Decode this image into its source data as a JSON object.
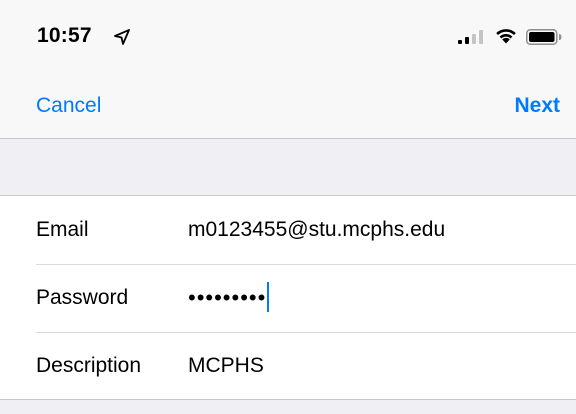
{
  "status_bar": {
    "time": "10:57",
    "location_icon": "location-arrow-icon",
    "signal_icon": "cellular-signal-icon",
    "wifi_icon": "wifi-icon",
    "battery_icon": "battery-icon"
  },
  "nav": {
    "cancel_label": "Cancel",
    "next_label": "Next"
  },
  "form": {
    "rows": [
      {
        "label": "Email",
        "value": "m0123455@stu.mcphs.edu"
      },
      {
        "label": "Password",
        "value": "•••••••••"
      },
      {
        "label": "Description",
        "value": "MCPHS"
      }
    ]
  },
  "colors": {
    "accent": "#007aff",
    "group_background": "#efeff4",
    "separator": "#c8c7cc"
  }
}
